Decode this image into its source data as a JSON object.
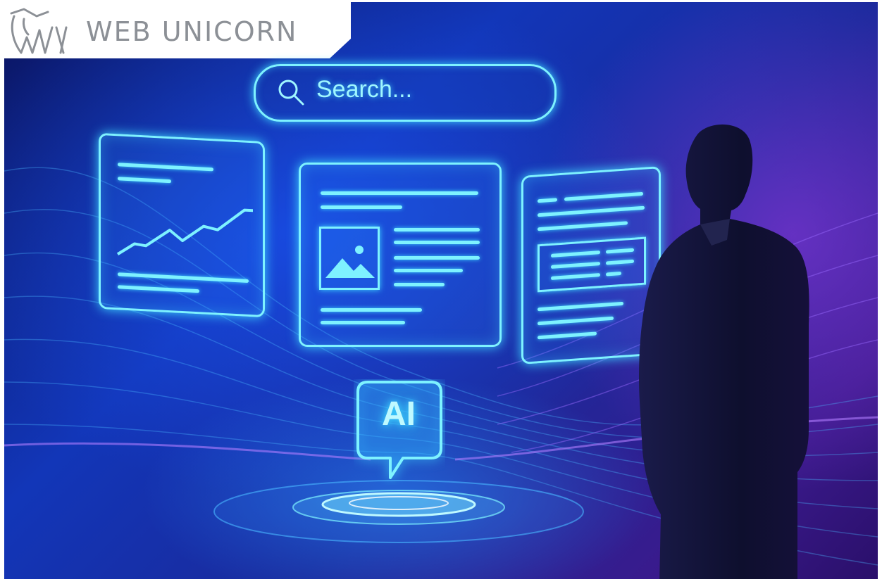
{
  "logo": {
    "text": "WEB UNICORN",
    "mark_icon": "unicorn-head-logo"
  },
  "search": {
    "placeholder": "Search...",
    "icon": "search-icon"
  },
  "ai_bubble": {
    "label": "AI"
  },
  "panels": [
    {
      "kind": "chart-card",
      "icon": "line-chart"
    },
    {
      "kind": "article-card",
      "icon": "image-placeholder-icon"
    },
    {
      "kind": "table-card",
      "icon": "text-lines"
    }
  ],
  "colors": {
    "glow": "#7ef2ff",
    "background_blue": "#1236b8",
    "background_purple": "#3a1a8c",
    "logo_gray": "#8c9096"
  }
}
